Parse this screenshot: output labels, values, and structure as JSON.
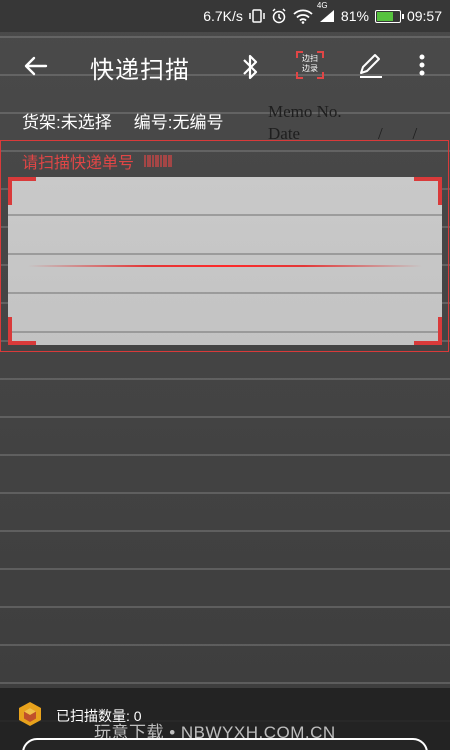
{
  "status_bar": {
    "speed": "6.7K/s",
    "network": "4G",
    "battery": "81%",
    "battery_level": 0.81,
    "time": "09:57"
  },
  "app_bar": {
    "title": "快递扫描",
    "scan_record_label_line1": "边扫",
    "scan_record_label_line2": "边录"
  },
  "info": {
    "shelf": "货架:未选择",
    "number": "编号:无编号"
  },
  "background_memo": {
    "memo": "Memo No.",
    "date": "Date",
    "slash": "/       /"
  },
  "scan": {
    "hint": "请扫描快递单号"
  },
  "bottom": {
    "count_label": "已扫描数量: 0",
    "watermark": "玩意下载 • NBWYXH.COM.CN"
  },
  "colors": {
    "accent": "#d93a3a",
    "battery_fill": "#56c23e"
  }
}
